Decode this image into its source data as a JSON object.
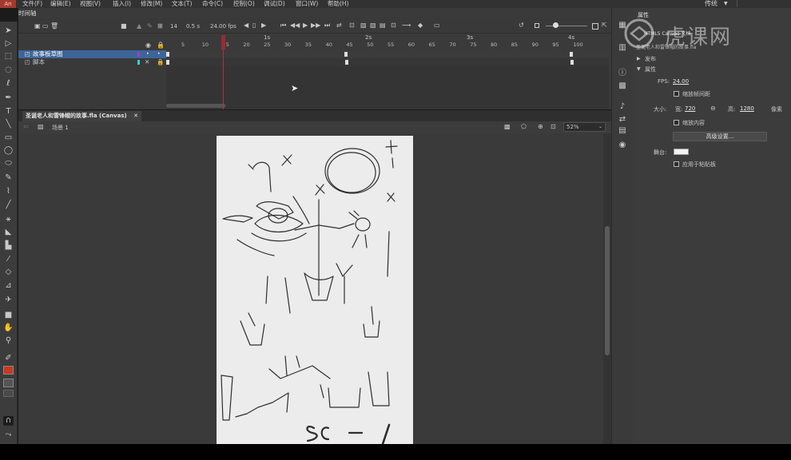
{
  "menubar": {
    "logo": "An",
    "items": [
      "文件(F)",
      "编辑(E)",
      "视图(V)",
      "插入(I)",
      "修改(M)",
      "文本(T)",
      "命令(C)",
      "控制(O)",
      "调试(D)",
      "窗口(W)",
      "帮助(H)"
    ],
    "workspace": "传统"
  },
  "timeline": {
    "tab_label": "时间轴",
    "current_frame": "14",
    "elapsed_time": "0.5 s",
    "fps": "24.00 fps",
    "ruler_seconds": [
      "1s",
      "2s",
      "3s",
      "4s"
    ],
    "ruler_frames": [
      "5",
      "10",
      "15",
      "20",
      "25",
      "30",
      "35",
      "40",
      "45",
      "50",
      "55",
      "60",
      "65",
      "70",
      "75",
      "80",
      "85",
      "90",
      "95",
      "100"
    ],
    "layers": [
      {
        "name": "故事板草图",
        "color": "#a53ad8",
        "selected": true
      },
      {
        "name": "脚本",
        "color": "#2ad6d2",
        "selected": false
      }
    ]
  },
  "document": {
    "tab_title": "圣诞老人和雷锋帽的故事.fla (Canvas)",
    "scene_label": "场景 1",
    "zoom": "52%"
  },
  "properties": {
    "panel_title": "属性",
    "doc_type": "HTML5 Canvas 文档",
    "doc_name": "圣诞老人和雷锋帽的故事.fla",
    "section_publish": "发布",
    "section_properties": "属性",
    "fps_label": "FPS:",
    "fps_value": "24.00",
    "scale_spacing_label": "缩放帧间距",
    "size_label": "大小:",
    "width_label": "宽:",
    "width_value": "720",
    "height_label": "高:",
    "height_value": "1280",
    "unit": "像素",
    "scale_content_label": "缩放内容",
    "advanced_button": "高级设置...",
    "stage_label": "舞台:",
    "stage_color": "#f2f2f2",
    "apply_pasteboard_label": "应用于粘贴板"
  },
  "watermark": {
    "text": "虎课网"
  },
  "colors": {
    "accent_playhead": "#b0323c",
    "stroke_color": "#c8391e",
    "selected_layer": "#3e6598"
  }
}
